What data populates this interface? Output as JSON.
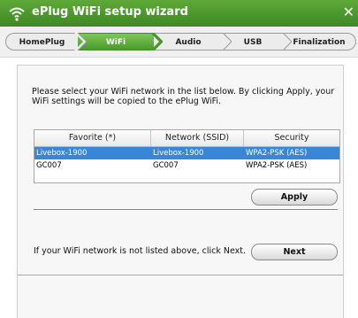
{
  "window": {
    "title": "ePlug WiFi setup wizard",
    "close_glyph": "✕"
  },
  "steps": [
    {
      "label": "HomePlug",
      "active": false
    },
    {
      "label": "WiFi",
      "active": true
    },
    {
      "label": "Audio",
      "active": false
    },
    {
      "label": "USB",
      "active": false
    },
    {
      "label": "Finalization",
      "active": false
    }
  ],
  "instructions": "Please select your WiFi network in the list below. By clicking Apply, your WiFi settings will be copied to the ePlug WiFi.",
  "table": {
    "headers": [
      "Favorite (*)",
      "Network (SSID)",
      "Security"
    ],
    "rows": [
      {
        "favorite": "Livebox-1900",
        "ssid": "Livebox-1900",
        "security": "WPA2-PSK (AES)",
        "selected": true
      },
      {
        "favorite": "GC007",
        "ssid": "GC007",
        "security": "WPA2-PSK (AES)",
        "selected": false
      }
    ]
  },
  "buttons": {
    "apply": "Apply",
    "next": "Next"
  },
  "next_hint": "If your WiFi network is not listed above, click Next.",
  "colors": {
    "title_bar": "#3c8a23",
    "active_step": "#4a9a2c",
    "selection": "#3a86d6"
  }
}
